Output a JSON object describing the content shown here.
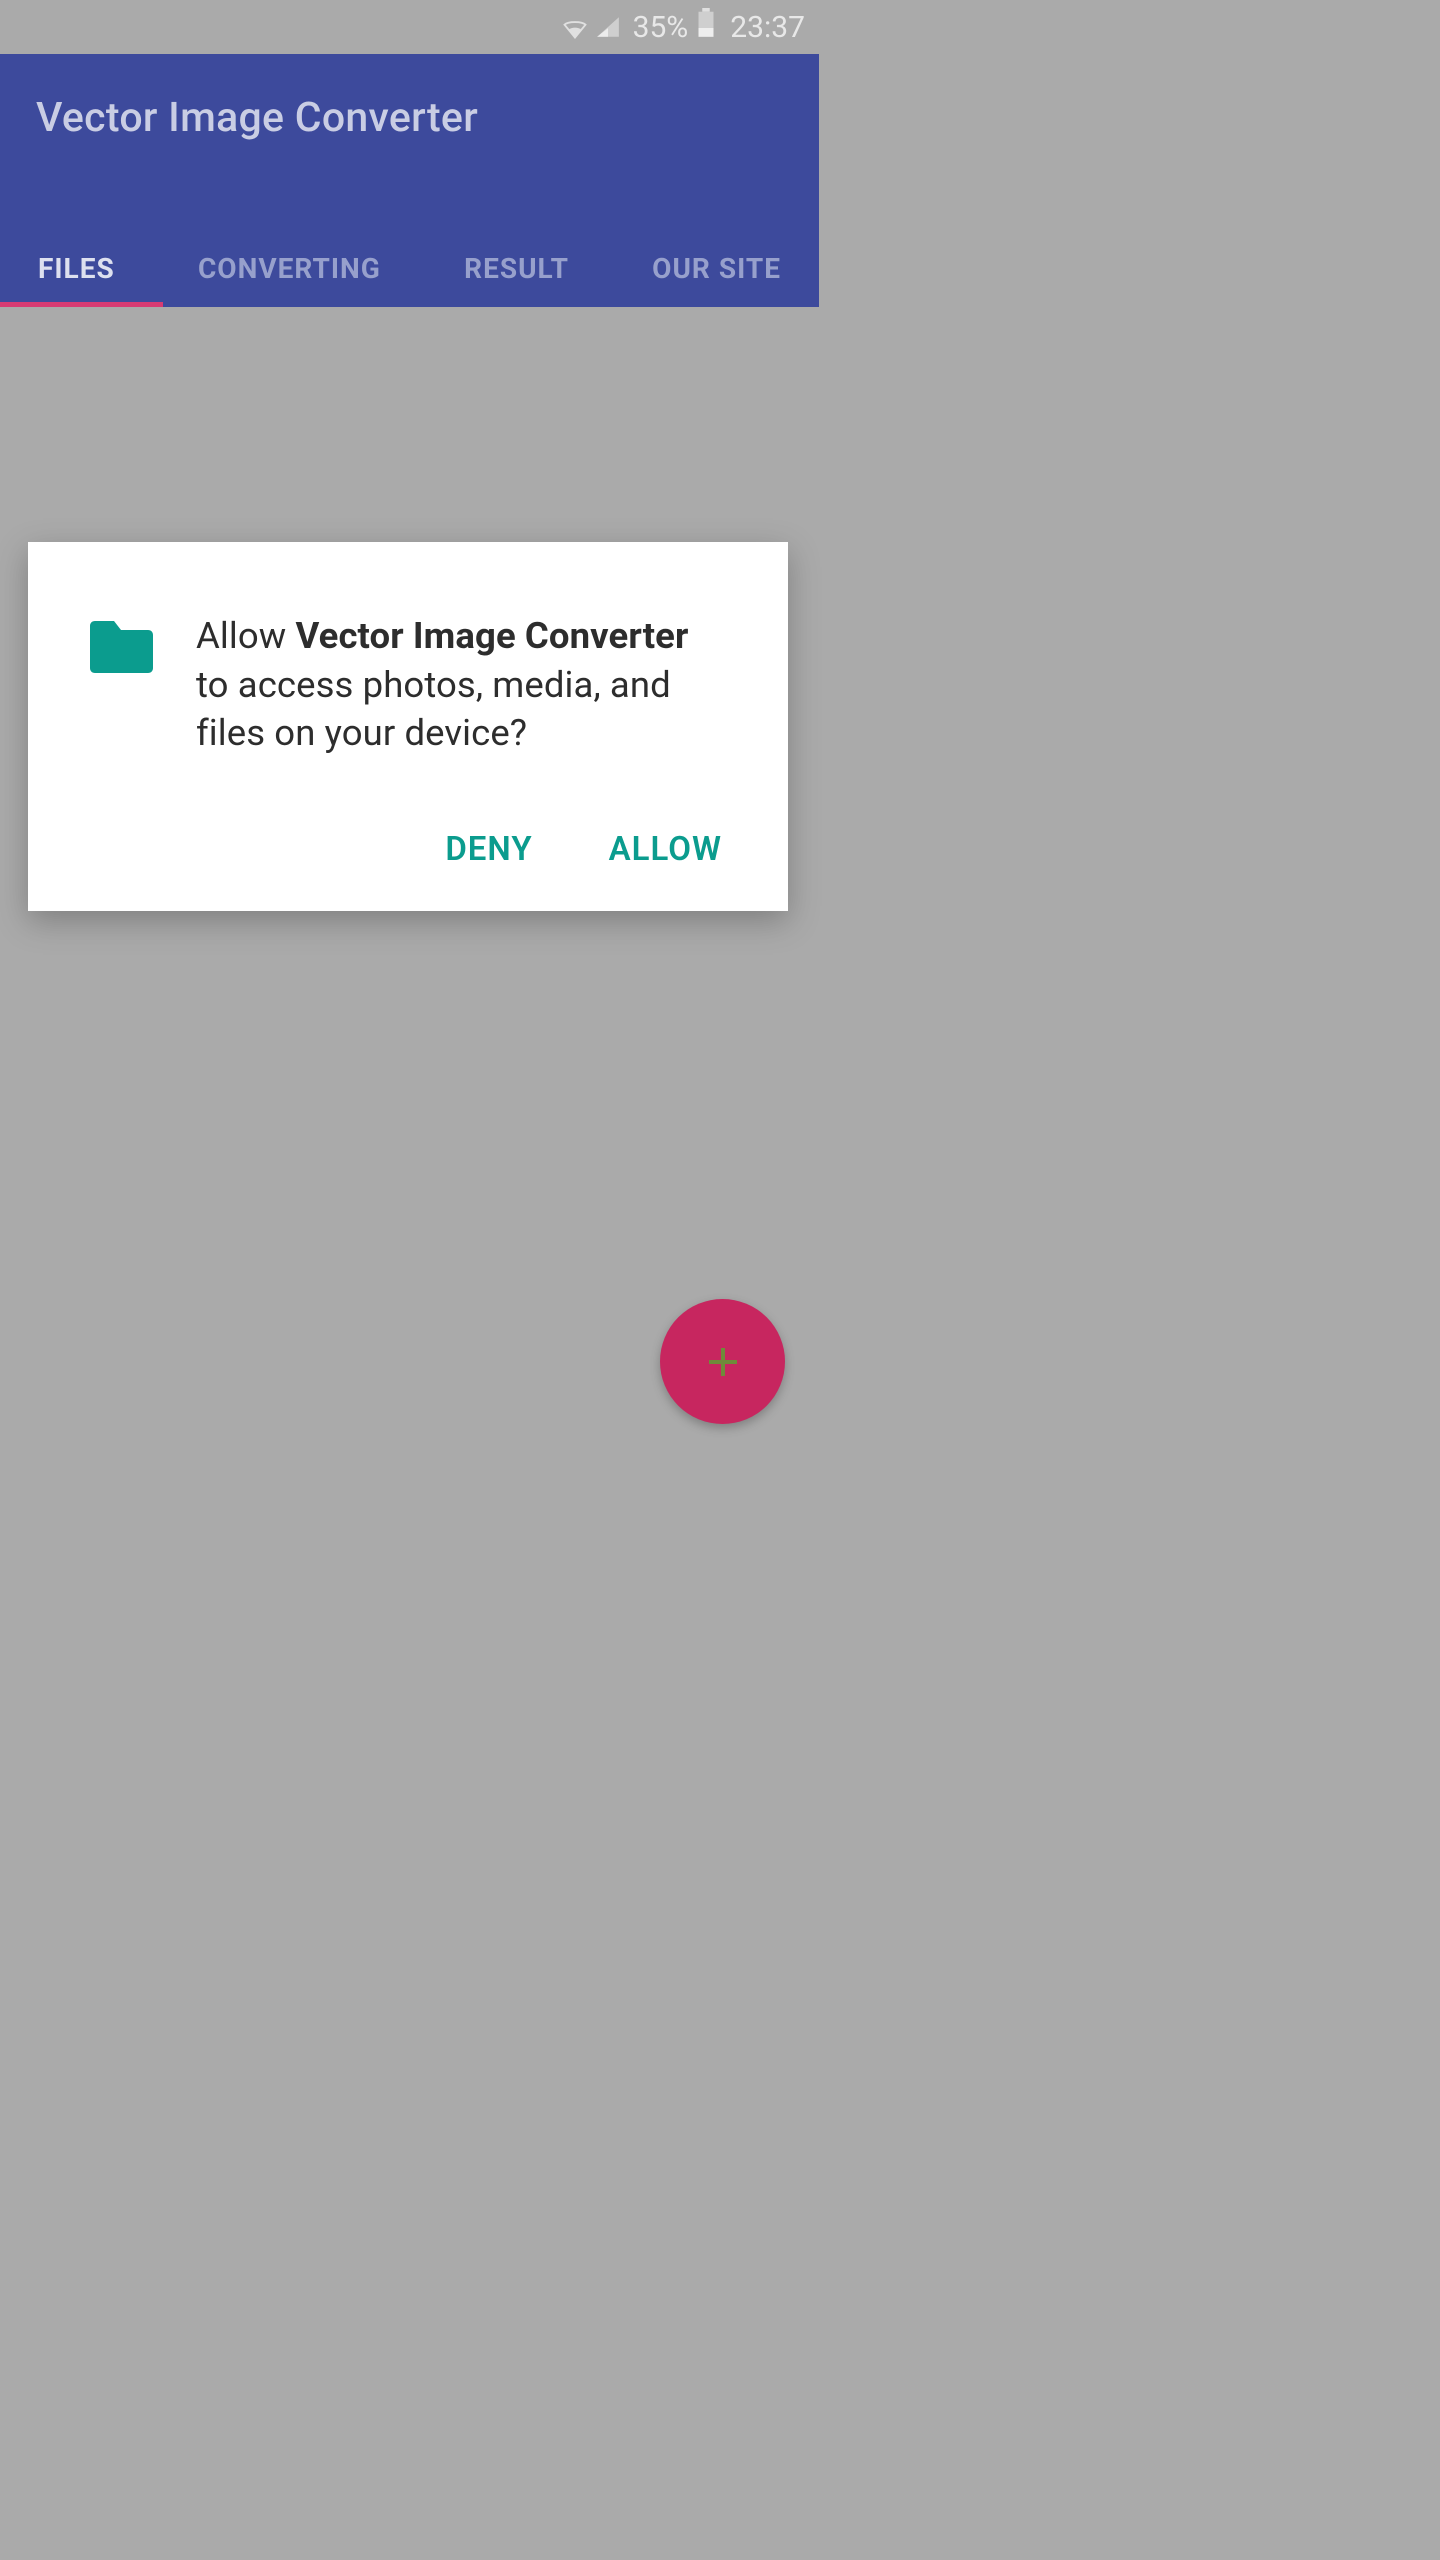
{
  "status": {
    "battery_pct": "35%",
    "time": "23:37"
  },
  "header": {
    "title": "Vector Image Converter"
  },
  "tabs": [
    {
      "label": "FILES",
      "active": true
    },
    {
      "label": "CONVERTING",
      "active": false
    },
    {
      "label": "RESULT",
      "active": false
    },
    {
      "label": "OUR SITE",
      "active": false
    }
  ],
  "dialog": {
    "prefix": "Allow ",
    "app_name": "Vector Image Converter",
    "suffix": " to access photos, media, and files on your device?",
    "deny": "DENY",
    "allow": "ALLOW"
  },
  "fab": {
    "name": "add"
  },
  "colors": {
    "appbar": "#3d4a9c",
    "accent": "#d83b73",
    "teal": "#0b9c8e",
    "fab": "#c7265f"
  }
}
